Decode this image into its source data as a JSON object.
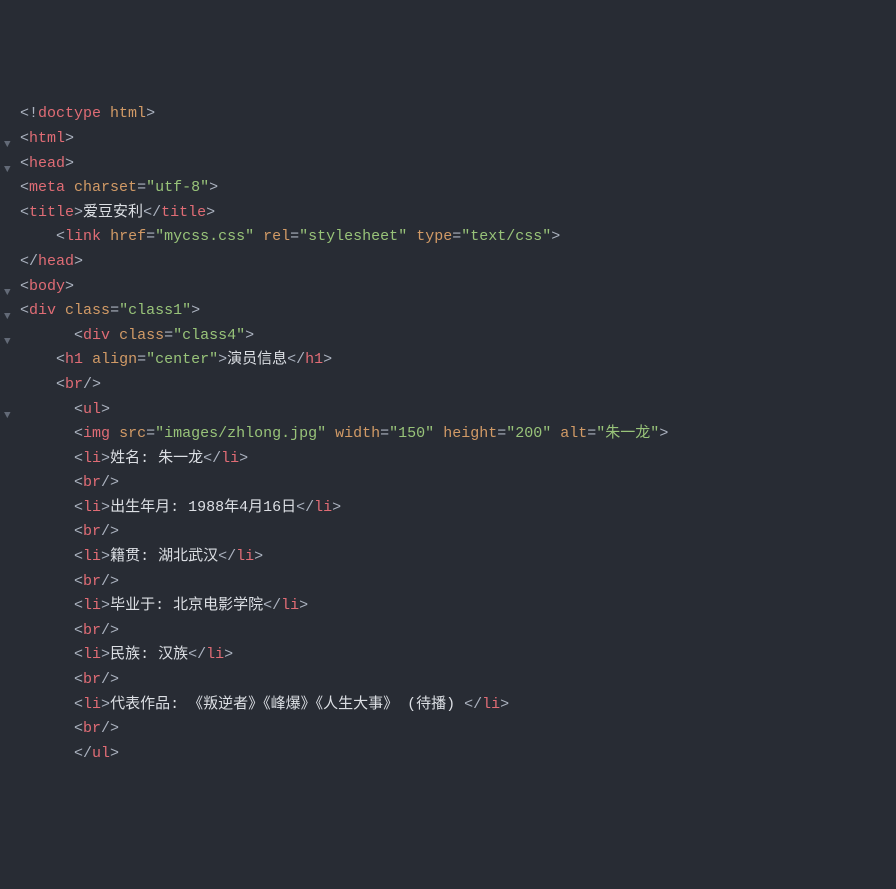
{
  "lines": [
    {
      "arrow": "",
      "indent": 0,
      "parts": [
        [
          "punct",
          "<!"
        ],
        [
          "tag",
          "doctype"
        ],
        [
          "punct",
          " "
        ],
        [
          "attr",
          "html"
        ],
        [
          "punct",
          ">"
        ]
      ]
    },
    {
      "arrow": "▼",
      "indent": 0,
      "parts": [
        [
          "punct",
          "<"
        ],
        [
          "tag",
          "html"
        ],
        [
          "punct",
          ">"
        ]
      ]
    },
    {
      "arrow": "▼",
      "indent": 0,
      "parts": [
        [
          "punct",
          "<"
        ],
        [
          "tag",
          "head"
        ],
        [
          "punct",
          ">"
        ]
      ]
    },
    {
      "arrow": "",
      "indent": 0,
      "parts": [
        [
          "punct",
          "<"
        ],
        [
          "tag",
          "meta"
        ],
        [
          "punct",
          " "
        ],
        [
          "attr",
          "charset"
        ],
        [
          "eq",
          "="
        ],
        [
          "string",
          "\"utf-8\""
        ],
        [
          "punct",
          ">"
        ]
      ]
    },
    {
      "arrow": "",
      "indent": 0,
      "parts": [
        [
          "punct",
          "<"
        ],
        [
          "tag",
          "title"
        ],
        [
          "punct",
          ">"
        ],
        [
          "text",
          "爱豆安利"
        ],
        [
          "punct",
          "</"
        ],
        [
          "tag",
          "title"
        ],
        [
          "punct",
          ">"
        ]
      ]
    },
    {
      "arrow": "",
      "indent": 2,
      "parts": [
        [
          "punct",
          "<"
        ],
        [
          "tag",
          "link"
        ],
        [
          "punct",
          " "
        ],
        [
          "attr",
          "href"
        ],
        [
          "eq",
          "="
        ],
        [
          "string",
          "\"mycss.css\""
        ],
        [
          "punct",
          " "
        ],
        [
          "attr",
          "rel"
        ],
        [
          "eq",
          "="
        ],
        [
          "string",
          "\"stylesheet\""
        ],
        [
          "punct",
          " "
        ],
        [
          "attr",
          "type"
        ],
        [
          "eq",
          "="
        ],
        [
          "string",
          "\"text/css\""
        ],
        [
          "punct",
          ">"
        ]
      ]
    },
    {
      "arrow": "",
      "indent": 0,
      "parts": [
        [
          "punct",
          "</"
        ],
        [
          "tag",
          "head"
        ],
        [
          "punct",
          ">"
        ]
      ]
    },
    {
      "arrow": "▼",
      "indent": 0,
      "parts": [
        [
          "punct",
          "<"
        ],
        [
          "tag",
          "body"
        ],
        [
          "punct",
          ">"
        ]
      ]
    },
    {
      "arrow": "",
      "indent": 0,
      "parts": []
    },
    {
      "arrow": "▼",
      "indent": 0,
      "parts": [
        [
          "punct",
          "<"
        ],
        [
          "tag",
          "div"
        ],
        [
          "punct",
          " "
        ],
        [
          "attr",
          "class"
        ],
        [
          "eq",
          "="
        ],
        [
          "string",
          "\"class1\""
        ],
        [
          "punct",
          ">"
        ]
      ]
    },
    {
      "arrow": "▼",
      "indent": 3,
      "parts": [
        [
          "punct",
          "<"
        ],
        [
          "tag",
          "div"
        ],
        [
          "punct",
          " "
        ],
        [
          "attr",
          "class"
        ],
        [
          "eq",
          "="
        ],
        [
          "string",
          "\"class4\""
        ],
        [
          "punct",
          ">"
        ]
      ]
    },
    {
      "arrow": "",
      "indent": 0,
      "parts": []
    },
    {
      "arrow": "",
      "indent": 2,
      "parts": [
        [
          "punct",
          "<"
        ],
        [
          "tag",
          "h1"
        ],
        [
          "punct",
          " "
        ],
        [
          "attr",
          "align"
        ],
        [
          "eq",
          "="
        ],
        [
          "string",
          "\"center\""
        ],
        [
          "punct",
          ">"
        ],
        [
          "text",
          "演员信息"
        ],
        [
          "punct",
          "</"
        ],
        [
          "tag",
          "h1"
        ],
        [
          "punct",
          ">"
        ]
      ]
    },
    {
      "arrow": "",
      "indent": 2,
      "parts": [
        [
          "punct",
          "<"
        ],
        [
          "tag",
          "br"
        ],
        [
          "punct",
          "/>"
        ]
      ]
    },
    {
      "arrow": "▼",
      "indent": 3,
      "parts": [
        [
          "punct",
          "<"
        ],
        [
          "tag",
          "ul"
        ],
        [
          "punct",
          ">"
        ]
      ]
    },
    {
      "arrow": "",
      "indent": 3,
      "parts": [
        [
          "punct",
          "<"
        ],
        [
          "tag",
          "img"
        ],
        [
          "punct",
          " "
        ],
        [
          "attr",
          "src"
        ],
        [
          "eq",
          "="
        ],
        [
          "string",
          "\"images/zhlong.jpg\""
        ],
        [
          "punct",
          " "
        ],
        [
          "attr",
          "width"
        ],
        [
          "eq",
          "="
        ],
        [
          "string",
          "\"150\""
        ],
        [
          "punct",
          " "
        ],
        [
          "attr",
          "height"
        ],
        [
          "eq",
          "="
        ],
        [
          "string",
          "\"200\""
        ],
        [
          "punct",
          " "
        ],
        [
          "attr",
          "alt"
        ],
        [
          "eq",
          "="
        ],
        [
          "string",
          "\"朱一龙\""
        ],
        [
          "punct",
          ">"
        ]
      ]
    },
    {
      "arrow": "",
      "indent": 3,
      "parts": [
        [
          "punct",
          "<"
        ],
        [
          "tag",
          "li"
        ],
        [
          "punct",
          ">"
        ],
        [
          "text",
          "姓名: 朱一龙"
        ],
        [
          "punct",
          "</"
        ],
        [
          "tag",
          "li"
        ],
        [
          "punct",
          ">"
        ]
      ]
    },
    {
      "arrow": "",
      "indent": 3,
      "parts": [
        [
          "punct",
          "<"
        ],
        [
          "tag",
          "br"
        ],
        [
          "punct",
          "/>"
        ]
      ]
    },
    {
      "arrow": "",
      "indent": 3,
      "parts": [
        [
          "punct",
          "<"
        ],
        [
          "tag",
          "li"
        ],
        [
          "punct",
          ">"
        ],
        [
          "text",
          "出生年月: 1988年4月16日"
        ],
        [
          "punct",
          "</"
        ],
        [
          "tag",
          "li"
        ],
        [
          "punct",
          ">"
        ]
      ]
    },
    {
      "arrow": "",
      "indent": 3,
      "parts": [
        [
          "punct",
          "<"
        ],
        [
          "tag",
          "br"
        ],
        [
          "punct",
          "/>"
        ]
      ]
    },
    {
      "arrow": "",
      "indent": 3,
      "parts": [
        [
          "punct",
          "<"
        ],
        [
          "tag",
          "li"
        ],
        [
          "punct",
          ">"
        ],
        [
          "text",
          "籍贯: 湖北武汉"
        ],
        [
          "punct",
          "</"
        ],
        [
          "tag",
          "li"
        ],
        [
          "punct",
          ">"
        ]
      ]
    },
    {
      "arrow": "",
      "indent": 3,
      "parts": [
        [
          "punct",
          "<"
        ],
        [
          "tag",
          "br"
        ],
        [
          "punct",
          "/>"
        ]
      ]
    },
    {
      "arrow": "",
      "indent": 3,
      "parts": [
        [
          "punct",
          "<"
        ],
        [
          "tag",
          "li"
        ],
        [
          "punct",
          ">"
        ],
        [
          "text",
          "毕业于: 北京电影学院"
        ],
        [
          "punct",
          "</"
        ],
        [
          "tag",
          "li"
        ],
        [
          "punct",
          ">"
        ]
      ]
    },
    {
      "arrow": "",
      "indent": 3,
      "parts": [
        [
          "punct",
          "<"
        ],
        [
          "tag",
          "br"
        ],
        [
          "punct",
          "/>"
        ]
      ]
    },
    {
      "arrow": "",
      "indent": 3,
      "parts": [
        [
          "punct",
          "<"
        ],
        [
          "tag",
          "li"
        ],
        [
          "punct",
          ">"
        ],
        [
          "text",
          "民族: 汉族"
        ],
        [
          "punct",
          "</"
        ],
        [
          "tag",
          "li"
        ],
        [
          "punct",
          ">"
        ]
      ]
    },
    {
      "arrow": "",
      "indent": 3,
      "parts": [
        [
          "punct",
          "<"
        ],
        [
          "tag",
          "br"
        ],
        [
          "punct",
          "/>"
        ]
      ]
    },
    {
      "arrow": "",
      "indent": 3,
      "parts": [
        [
          "punct",
          "<"
        ],
        [
          "tag",
          "li"
        ],
        [
          "punct",
          ">"
        ],
        [
          "text",
          "代表作品: 《叛逆者》《峰爆》《人生大事》 (待播) "
        ],
        [
          "punct",
          "</"
        ],
        [
          "tag",
          "li"
        ],
        [
          "punct",
          ">"
        ]
      ]
    },
    {
      "arrow": "",
      "indent": 3,
      "parts": [
        [
          "punct",
          "<"
        ],
        [
          "tag",
          "br"
        ],
        [
          "punct",
          "/>"
        ]
      ]
    },
    {
      "arrow": "",
      "indent": 3,
      "parts": [
        [
          "punct",
          "</"
        ],
        [
          "tag",
          "ul"
        ],
        [
          "punct",
          ">"
        ]
      ]
    }
  ],
  "indent_unit": "  "
}
